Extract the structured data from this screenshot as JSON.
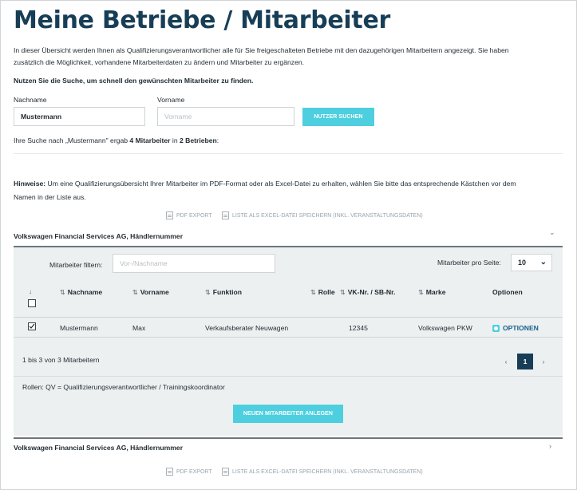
{
  "page": {
    "title": "Meine Betriebe / Mitarbeiter",
    "intro_line1": "In dieser Übersicht werden Ihnen als Qualifizierungsverantwortlicher alle für Sie freigeschalteten Betriebe mit den dazugehörigen Mitarbeitern angezeigt. Sie haben",
    "intro_line2": "zusätzlich die Möglichkeit, vorhandene Mitarbeiterdaten zu ändern und Mitarbeiter zu ergänzen.",
    "search_hint": "Nutzen Sie die Suche, um schnell den gewünschten Mitarbeiter zu finden."
  },
  "search": {
    "lastname_label": "Nachname",
    "lastname_value": "Mustermann",
    "firstname_label": "Vorname",
    "firstname_placeholder": "Vorname",
    "button": "NUTZER SUCHEN"
  },
  "result": {
    "prefix": "Ihre Suche nach „Mustermann\" ergab ",
    "count": "4 Mitarbeiter",
    "middle": " in ",
    "companies": "2 Betrieben",
    "suffix": ":"
  },
  "notes": {
    "label": "Hinweise:",
    "text_line1": " Um eine Qualifizierungsübersicht Ihrer Mitarbeiter im PDF-Format oder als Excel-Datei zu erhalten, wählen Sie bitte das entsprechende Kästchen vor dem",
    "text_line2": "Namen in der Liste aus."
  },
  "exports": {
    "pdf": "PDF EXPORT",
    "excel": "LISTE ALS EXCEL-DATEI SPEICHERN (INKL. VERANSTALTUNGSDATEN)"
  },
  "companies": [
    {
      "name": "Volkswagen Financial Services AG, Händlernummer",
      "expanded": true
    },
    {
      "name": "Volkswagen Financial Services AG, Händlernummer",
      "expanded": false
    }
  ],
  "table": {
    "filter_label": "Mitarbeiter filtern:",
    "filter_placeholder": "Vor-/Nachname",
    "per_page_label": "Mitarbeiter pro Seite:",
    "per_page_value": "10",
    "select_arrow": "↓",
    "columns": {
      "lastname": "Nachname",
      "firstname": "Vorname",
      "function": "Funktion",
      "role": "Rolle",
      "vknr": "VK-Nr. / SB-Nr.",
      "brand": "Marke",
      "options": "Optionen"
    },
    "rows": [
      {
        "lastname": "Mustermann",
        "firstname": "Max",
        "function": "Verkaufsberater Neuwagen",
        "role": "",
        "vknr": "12345",
        "brand": "Volkswagen PKW",
        "options": "OPTIONEN",
        "checked": true
      }
    ],
    "range_text": "1 bis 3 von 3 Mitarbeitern",
    "page": "1",
    "prev": "‹",
    "next": "›",
    "roles_text": "Rollen: QV = Qualifizierungsverantwortlicher / Trainingskoordinator",
    "new_button": "NEUEN MITARBEITER ANLEGEN"
  },
  "colors": {
    "accent": "#4dcfe0",
    "title": "#173e56",
    "link": "#16608c"
  }
}
